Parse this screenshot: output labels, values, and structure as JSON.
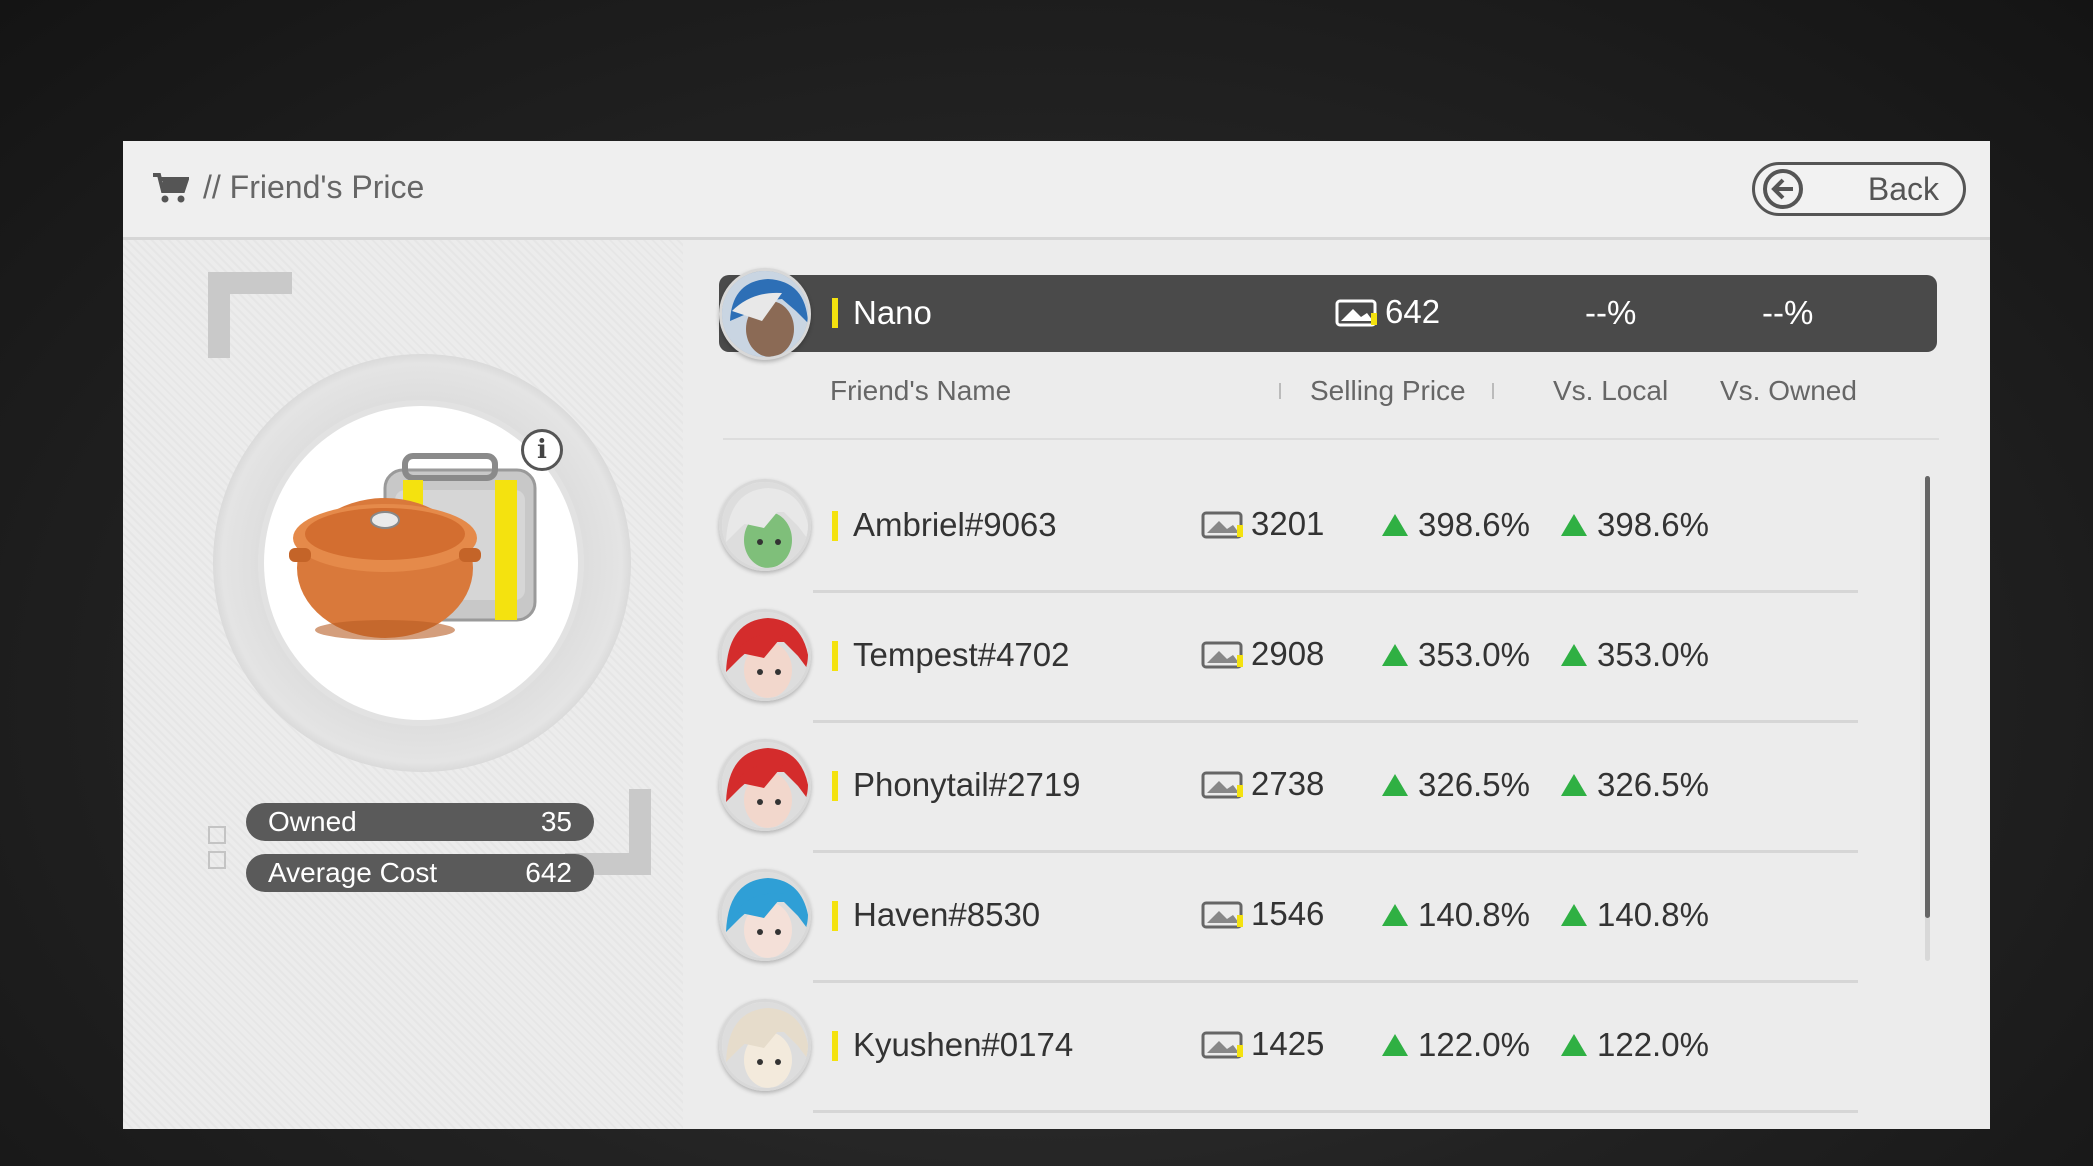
{
  "header": {
    "title": "// Friend's Price",
    "back_label": "Back"
  },
  "item": {
    "owned_label": "Owned",
    "owned_value": "35",
    "avg_cost_label": "Average Cost",
    "avg_cost_value": "642"
  },
  "self": {
    "name": "Nano",
    "price": "642",
    "vs_local": "--%",
    "vs_owned": "--%"
  },
  "columns": {
    "name": "Friend's Name",
    "price": "Selling Price",
    "vs_local": "Vs. Local",
    "vs_owned": "Vs. Owned"
  },
  "friends": [
    {
      "name": "Ambriel#9063",
      "price": "3201",
      "vs_local": "398.6%",
      "vs_owned": "398.6%",
      "avatar_color": "#7fbf7a",
      "hair_color": "#e8e8e8"
    },
    {
      "name": "Tempest#4702",
      "price": "2908",
      "vs_local": "353.0%",
      "vs_owned": "353.0%",
      "avatar_color": "#f2d7cc",
      "hair_color": "#d42c2c"
    },
    {
      "name": "Phonytail#2719",
      "price": "2738",
      "vs_local": "326.5%",
      "vs_owned": "326.5%",
      "avatar_color": "#f2d7cc",
      "hair_color": "#d42c2c"
    },
    {
      "name": "Haven#8530",
      "price": "1546",
      "vs_local": "140.8%",
      "vs_owned": "140.8%",
      "avatar_color": "#f4e0d8",
      "hair_color": "#2f9fd6"
    },
    {
      "name": "Kyushen#0174",
      "price": "1425",
      "vs_local": "122.0%",
      "vs_owned": "122.0%",
      "avatar_color": "#f3eadc",
      "hair_color": "#e6dccb"
    }
  ],
  "colors": {
    "accent_yellow": "#f4e20f",
    "up_green": "#2fb043",
    "self_bar": "#4a4a4a"
  }
}
